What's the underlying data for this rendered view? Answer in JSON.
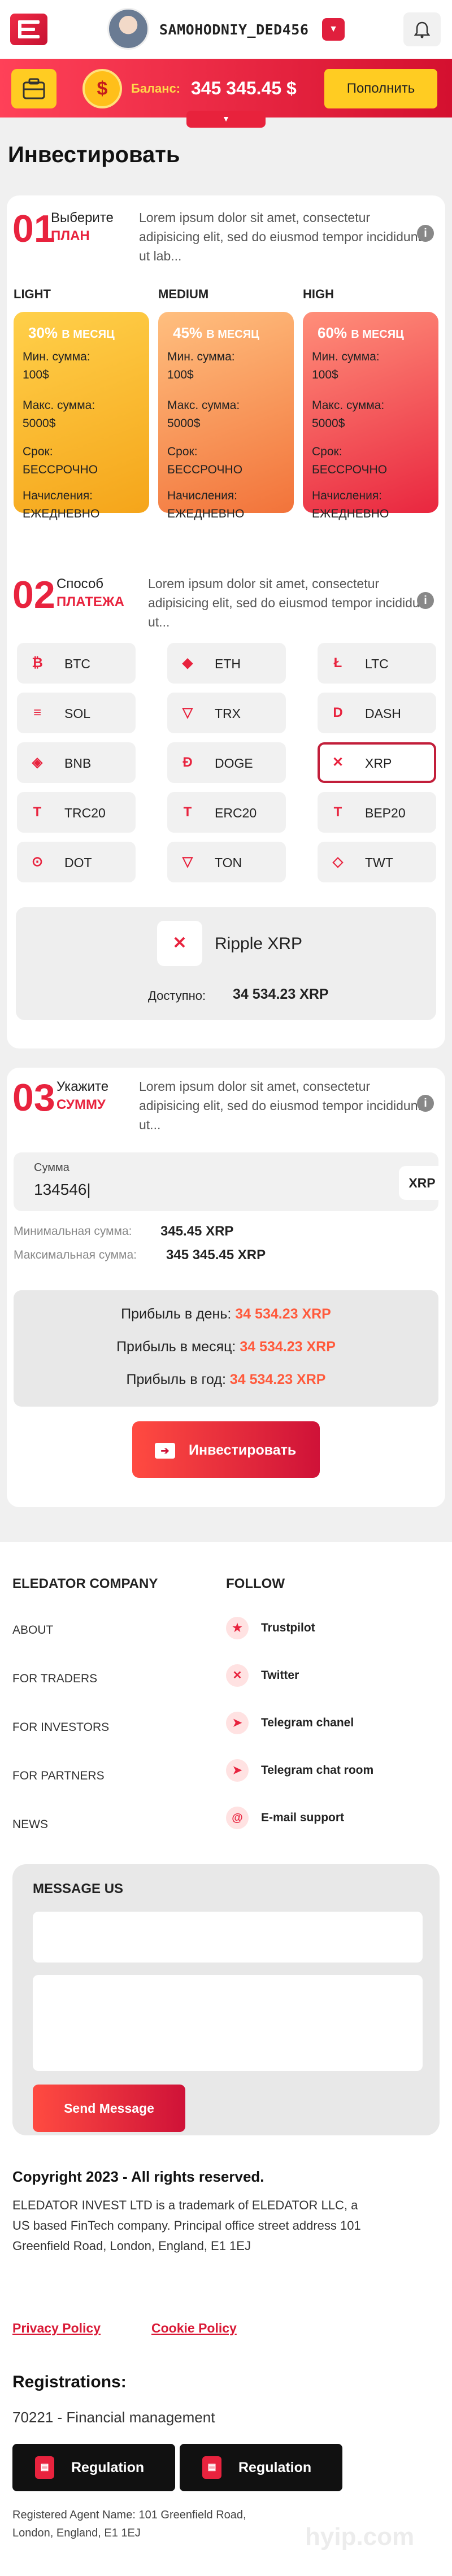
{
  "header": {
    "username": "SAMOHODNIY_DED456",
    "balance_label": "Баланс:",
    "balance_value": "345 345.45 $",
    "topup_label": "Пополнить",
    "coin_symbol": "$"
  },
  "page_title": "Инвестировать",
  "step1": {
    "num": "01",
    "line1": "Выберите",
    "line2": "ПЛАН",
    "desc": "Lorem ipsum dolor sit amet, consectetur adipisicing elit, sed do eiusmod tempor incididunt ut lab...",
    "plans": [
      {
        "name": "LIGHT",
        "pct": "30%",
        "period": "В МЕСЯЦ",
        "min_label": "Мин. сумма:",
        "min": "100$",
        "max_label": "Макс. сумма:",
        "max": "5000$",
        "term_label": "Срок:",
        "term": "БЕССРОЧНО",
        "accr_label": "Начисления:",
        "accr": "ЕЖЕДНЕВНО"
      },
      {
        "name": "MEDIUM",
        "pct": "45%",
        "period": "В МЕСЯЦ",
        "min_label": "Мин. сумма:",
        "min": "100$",
        "max_label": "Макс. сумма:",
        "max": "5000$",
        "term_label": "Срок:",
        "term": "БЕССРОЧНО",
        "accr_label": "Начисления:",
        "accr": "ЕЖЕДНЕВНО"
      },
      {
        "name": "HIGH",
        "pct": "60%",
        "period": "В МЕСЯЦ",
        "min_label": "Мин. сумма:",
        "min": "100$",
        "max_label": "Макс. сумма:",
        "max": "5000$",
        "term_label": "Срок:",
        "term": "БЕССРОЧНО",
        "accr_label": "Начисления:",
        "accr": "ЕЖЕДНЕВНО"
      }
    ]
  },
  "step2": {
    "num": "02",
    "line1": "Способ",
    "line2": "ПЛАТЕЖА",
    "desc": "Lorem ipsum dolor sit amet, consectetur adipisicing elit, sed do eiusmod tempor incididunt ut...",
    "methods": [
      {
        "label": "BTC",
        "icon": "₿"
      },
      {
        "label": "ETH",
        "icon": "◆"
      },
      {
        "label": "LTC",
        "icon": "Ł"
      },
      {
        "label": "SOL",
        "icon": "≡"
      },
      {
        "label": "TRX",
        "icon": "▽"
      },
      {
        "label": "DASH",
        "icon": "D"
      },
      {
        "label": "BNB",
        "icon": "◈"
      },
      {
        "label": "DOGE",
        "icon": "Ð"
      },
      {
        "label": "XRP",
        "icon": "✕"
      },
      {
        "label": "TRC20",
        "icon": "T"
      },
      {
        "label": "ERC20",
        "icon": "T"
      },
      {
        "label": "BEP20",
        "icon": "T"
      },
      {
        "label": "DOT",
        "icon": "⊙"
      },
      {
        "label": "TON",
        "icon": "▽"
      },
      {
        "label": "TWT",
        "icon": "◇"
      }
    ],
    "selected_name": "Ripple XRP",
    "available_label": "Доступно:",
    "available_value": "34 534.23 XRP"
  },
  "step3": {
    "num": "03",
    "line1": "Укажите",
    "line2": "СУММУ",
    "desc": "Lorem ipsum dolor sit amet, consectetur adipisicing elit, sed do eiusmod tempor incididunt ut...",
    "amount_label": "Сумма",
    "amount_value": "134546|",
    "amount_unit": "XRP",
    "min_label": "Минимальная сумма:",
    "min_value": "345.45 XRP",
    "max_label": "Максимальная сумма:",
    "max_value": "345 345.45 XRP",
    "profit_day_label": "Прибыль в день:",
    "profit_day": "34 534.23 XRP",
    "profit_month_label": "Прибыль в месяц:",
    "profit_month": "34 534.23 XRP",
    "profit_year_label": "Прибыль в год:",
    "profit_year": "34 534.23 XRP",
    "invest_label": "Инвестировать"
  },
  "footer": {
    "company_title": "ELEDATOR COMPANY",
    "follow_title": "FOLLOW",
    "links": [
      "ABOUT",
      "FOR TRADERS",
      "FOR INVESTORS",
      "FOR PARTNERS",
      "NEWS"
    ],
    "social": [
      "Trustpilot",
      "Twitter",
      "Telegram chanel",
      "Telegram chat room",
      "E-mail support"
    ],
    "message_title": "MESSAGE US",
    "send_label": "Send Message",
    "copyright": "Copyright  2023 - All rights reserved.",
    "legal": "ELEDATOR INVEST LTD is a trademark of ELEDATOR LLC, a US based FinTech company. Principal office street address 101 Greenfield Road, London, England, E1 1EJ",
    "privacy": "Privacy Policy",
    "cookie": "Cookie Policy",
    "reg_title": "Registrations:",
    "reg_sub": "70221 - Financial management",
    "reg_btn": "Regulation",
    "agent": "Registered Agent Name: 101 Greenfield Road, London, England, E1 1EJ",
    "watermark": "hyip.com"
  },
  "colors": {
    "accent": "#e8233e",
    "yellow": "#ffcc22",
    "profit": "#ff5a3c"
  }
}
